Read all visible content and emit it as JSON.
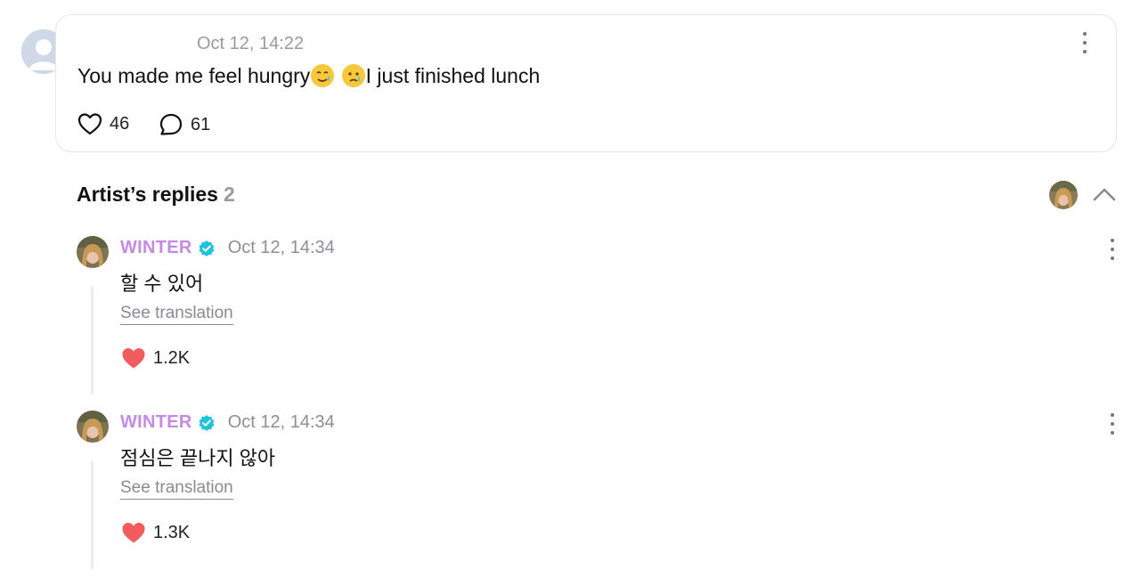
{
  "comment": {
    "timestamp": "Oct 12, 14:22",
    "text_before": "You made me feel hungry",
    "emoji_1": "smiling-face-with-tear",
    "emoji_2": "crying-face",
    "text_after": "I just finished lunch",
    "likes": "46",
    "replies": "61"
  },
  "artist_replies": {
    "title": "Artist’s replies",
    "count": "2",
    "items": [
      {
        "author": "WINTER",
        "timestamp": "Oct 12, 14:34",
        "text": "할 수 있어",
        "translate_label": "See translation",
        "likes": "1.2K"
      },
      {
        "author": "WINTER",
        "timestamp": "Oct 12, 14:34",
        "text": "점심은 끝나지 않아",
        "translate_label": "See translation",
        "likes": "1.3K"
      }
    ]
  },
  "colors": {
    "author": "#c48be6",
    "verified_badge": "#1fc3d9",
    "heart_filled": "#f25c5c",
    "muted_text": "#9a9aa1",
    "card_border": "#e6e6e9"
  }
}
